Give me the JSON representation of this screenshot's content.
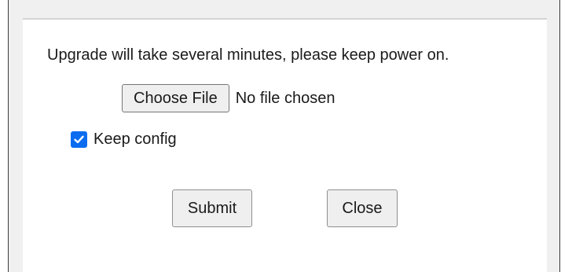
{
  "dialog": {
    "message": "Upgrade will take several minutes, please keep power on.",
    "file_button_label": "Choose File",
    "file_status": "No file chosen",
    "keep_config_label": "Keep config",
    "keep_config_checked": true,
    "submit_label": "Submit",
    "close_label": "Close"
  },
  "colors": {
    "checkbox_accent": "#0b6cf0",
    "button_bg": "#efefef",
    "frame_bg": "#f0f0f0"
  }
}
